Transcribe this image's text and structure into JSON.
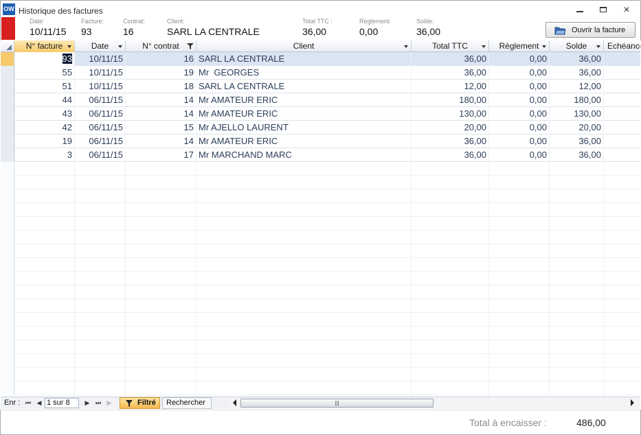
{
  "window": {
    "app_icon": "OW",
    "title": "Historique des factures",
    "controls": {
      "minimize": "minimize-icon",
      "restore": "restore-icon",
      "close": "×"
    }
  },
  "header": {
    "date_label": "Date:",
    "date_value": "10/11/15",
    "facture_label": "Facture:",
    "facture_value": "93",
    "contrat_label": "Contrat:",
    "contrat_value": "16",
    "client_label": "Client:",
    "client_value": "SARL LA CENTRALE",
    "total_label": "Total TTC :",
    "total_value": "36,00",
    "reglement_label": "Règlement:",
    "reglement_value": "0,00",
    "solde_label": "Solde:",
    "solde_value": "36,00",
    "open_button": "Ouvrir la facture",
    "accent_color": "#d81e1e"
  },
  "grid": {
    "columns": [
      "N° facture",
      "Date",
      "N° contrat",
      "Client",
      "Total TTC",
      "Règlement",
      "Solde",
      "Echéance"
    ],
    "rows": [
      {
        "facture": "93",
        "date": "10/11/15",
        "contrat": "16",
        "client": "SARL LA CENTRALE",
        "total": "36,00",
        "reglement": "0,00",
        "solde": "36,00"
      },
      {
        "facture": "55",
        "date": "10/11/15",
        "contrat": "19",
        "client": "Mr  GEORGES",
        "total": "36,00",
        "reglement": "0,00",
        "solde": "36,00"
      },
      {
        "facture": "51",
        "date": "10/11/15",
        "contrat": "18",
        "client": "SARL LA CENTRALE",
        "total": "12,00",
        "reglement": "0,00",
        "solde": "12,00"
      },
      {
        "facture": "44",
        "date": "06/11/15",
        "contrat": "14",
        "client": "Mr AMATEUR ERIC",
        "total": "180,00",
        "reglement": "0,00",
        "solde": "180,00"
      },
      {
        "facture": "43",
        "date": "06/11/15",
        "contrat": "14",
        "client": "Mr AMATEUR ERIC",
        "total": "130,00",
        "reglement": "0,00",
        "solde": "130,00"
      },
      {
        "facture": "42",
        "date": "06/11/15",
        "contrat": "15",
        "client": "Mr AJELLO LAURENT",
        "total": "20,00",
        "reglement": "0,00",
        "solde": "20,00"
      },
      {
        "facture": "19",
        "date": "06/11/15",
        "contrat": "14",
        "client": "Mr AMATEUR ERIC",
        "total": "36,00",
        "reglement": "0,00",
        "solde": "36,00"
      },
      {
        "facture": "3",
        "date": "06/11/15",
        "contrat": "17",
        "client": "Mr MARCHAND MARC",
        "total": "36,00",
        "reglement": "0,00",
        "solde": "36,00"
      }
    ]
  },
  "navigation": {
    "label": "Enr :",
    "counter": "1 sur 8",
    "filter_label": "Filtré",
    "search_label": "Rechercher",
    "scroll_grip": "|||"
  },
  "footer": {
    "label": "Total à encaisser :",
    "value": "486,00"
  }
}
